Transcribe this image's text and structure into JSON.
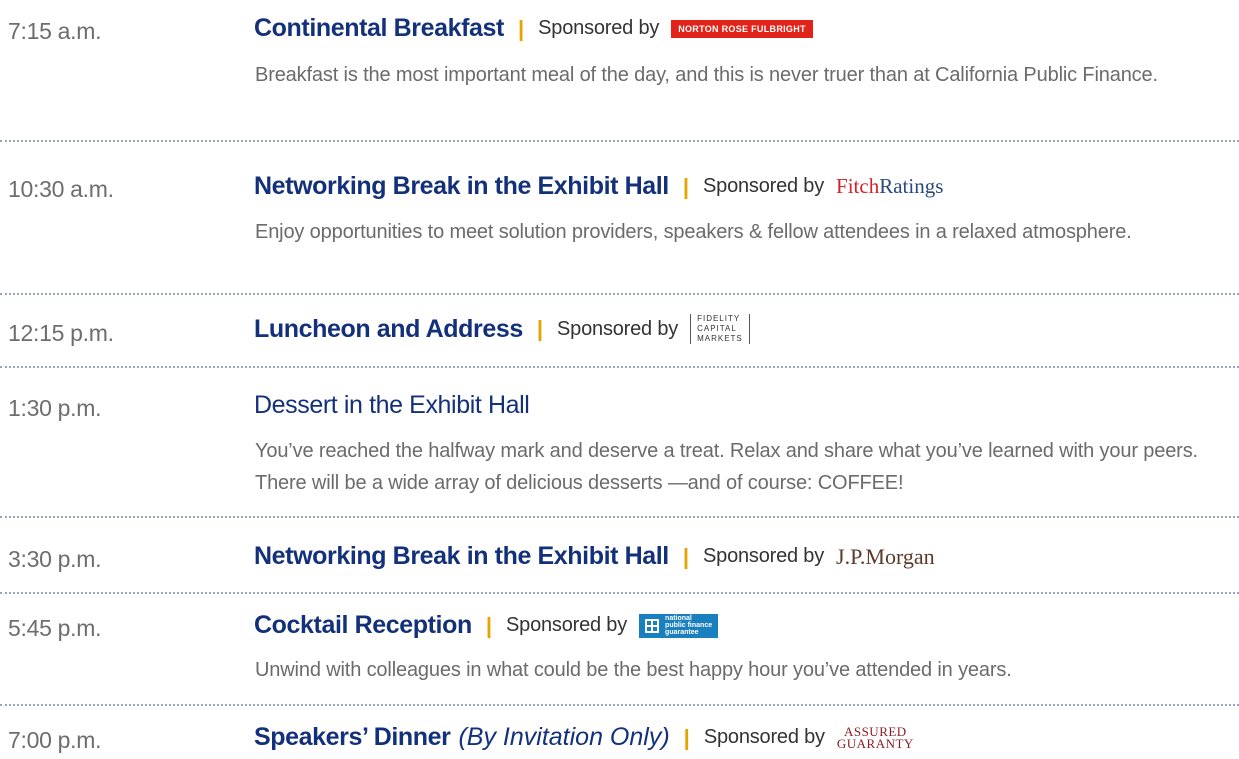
{
  "sponsor_prefix": "Sponsored by",
  "separator": "|",
  "events": [
    {
      "time": "7:15 a.m.",
      "title": "Continental Breakfast",
      "sponsor_logo": "NORTON ROSE FULBRIGHT",
      "description": "Breakfast is the most important meal of the day, and this is never truer than at California Public Finance."
    },
    {
      "time": "10:30 a.m.",
      "title": "Networking Break in the Exhibit Hall",
      "sponsor_logo_a": "Fitch",
      "sponsor_logo_b": "Ratings",
      "description": "Enjoy opportunities to meet solution providers, speakers & fellow attendees in a relaxed atmosphere."
    },
    {
      "time": "12:15 p.m.",
      "title": "Luncheon and Address",
      "sponsor_logo_lines": [
        "FIDELITY",
        "CAPITAL",
        "MARKETS"
      ]
    },
    {
      "time": "1:30 p.m.",
      "title": "Dessert in the Exhibit Hall",
      "description": "You’ve reached the halfway mark and deserve a treat. Relax and share what you’ve learned with your peers. There will be a wide array of delicious desserts —and of course: COFFEE!"
    },
    {
      "time": "3:30 p.m.",
      "title": "Networking Break in the Exhibit Hall",
      "sponsor_logo": "J.P.Morgan"
    },
    {
      "time": "5:45 p.m.",
      "title": "Cocktail Reception",
      "sponsor_logo_lines": [
        "national",
        "public finance",
        "guarantee"
      ],
      "description": "Unwind with colleagues in what could be the best happy hour you’ve attended in years."
    },
    {
      "time": "7:00 p.m.",
      "title": "Speakers’ Dinner",
      "qualifier": "(By Invitation Only)",
      "sponsor_logo_lines": [
        "ASSURED",
        "GUARANTY"
      ]
    }
  ],
  "colors": {
    "title": "#13307a",
    "separator": "#e5a400",
    "body_text": "#6b6b6b",
    "divider": "#9aa4b6"
  }
}
